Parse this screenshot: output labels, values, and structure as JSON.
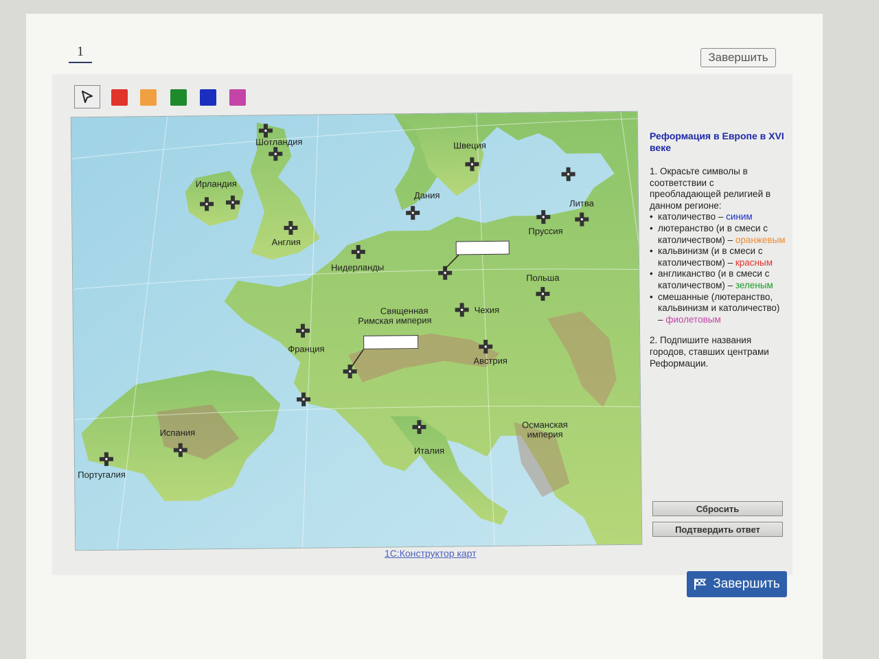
{
  "header": {
    "question_number": "1",
    "finish_top_label": "Завершить"
  },
  "toolbar": {
    "colors": [
      {
        "name": "red",
        "hex": "#e0342c"
      },
      {
        "name": "orange",
        "hex": "#f0a040"
      },
      {
        "name": "green",
        "hex": "#1e8a2c"
      },
      {
        "name": "blue",
        "hex": "#1a2fbf"
      },
      {
        "name": "purple",
        "hex": "#c445a8"
      }
    ]
  },
  "map": {
    "labels": {
      "scotland": "Шотландия",
      "sweden": "Швеция",
      "ireland": "Ирландия",
      "denmark": "Дания",
      "lithuania": "Литва",
      "prussia": "Пруссия",
      "england": "Англия",
      "netherlands": "Нидерланды",
      "poland": "Польша",
      "hre_line1": "Священная",
      "hre_line2": "Римская империя",
      "czech": "Чехия",
      "france": "Франция",
      "austria": "Австрия",
      "spain": "Испания",
      "portugal": "Португалия",
      "italy": "Италия",
      "ottoman_line1": "Османская",
      "ottoman_line2": "империя"
    }
  },
  "sidebar": {
    "title": "Реформация в Европе в XVI веке",
    "task1_intro": "1. Окрасьте символы в соответствии с преобладающей религией в данном регионе:",
    "items": [
      {
        "text": "католичество – ",
        "color_word": "синим",
        "hex": "#1a2fbf"
      },
      {
        "text": "лютеранство (и в смеси с католичеством) – ",
        "color_word": "оранжевым",
        "hex": "#f08a30"
      },
      {
        "text": "кальвинизм (и в смеси с католичеством) – ",
        "color_word": "красным",
        "hex": "#e0342c"
      },
      {
        "text": "англиканство (и в смеси с католичеством) – ",
        "color_word": "зеленым",
        "hex": "#1e9a2c"
      },
      {
        "text": "смешанные (лютеранство, кальвинизм и католичество) – ",
        "color_word": "фиолетовым",
        "hex": "#c445a8"
      }
    ],
    "task2": "2. Подпишите названия городов, ставших центрами Реформации.",
    "reset_label": "Сбросить",
    "confirm_label": "Подтвердить ответ"
  },
  "footer": {
    "credit": "1С:Конструктор карт",
    "finish_label": "Завершить"
  }
}
